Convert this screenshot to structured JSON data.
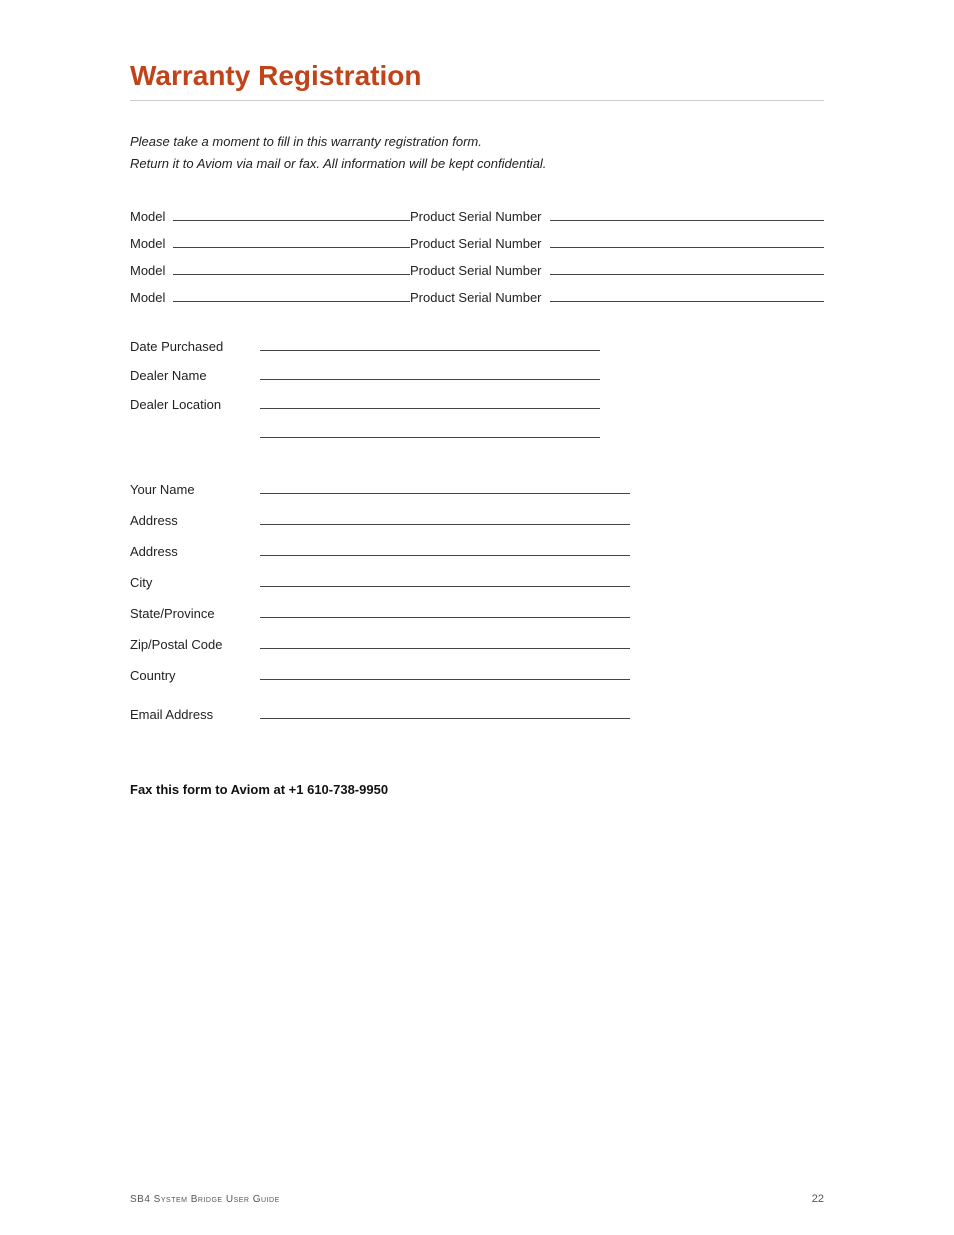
{
  "title": "Warranty Registration",
  "intro": {
    "line1": "Please take a moment to fill in this warranty registration form.",
    "line2": "Return it to Aviom via mail or fax. All information will be kept confidential."
  },
  "model_rows": [
    {
      "model_label": "Model",
      "serial_label": "Product Serial Number"
    },
    {
      "model_label": "Model",
      "serial_label": "Product Serial Number"
    },
    {
      "model_label": "Model",
      "serial_label": "Product Serial Number"
    },
    {
      "model_label": "Model",
      "serial_label": "Product Serial Number"
    }
  ],
  "dealer_fields": [
    {
      "label": "Date Purchased"
    },
    {
      "label": "Dealer Name"
    },
    {
      "label": "Dealer Location"
    }
  ],
  "contact_fields": [
    {
      "label": "Your Name"
    },
    {
      "label": "Address"
    },
    {
      "label": "Address"
    },
    {
      "label": "City"
    },
    {
      "label": "State/Province"
    },
    {
      "label": "Zip/Postal Code"
    },
    {
      "label": "Country"
    }
  ],
  "email_label": "Email Address",
  "fax_text": "Fax this form to Aviom at +1 610-738-9950",
  "footer": {
    "left": "SB4 System Bridge User Guide",
    "right": "22"
  }
}
